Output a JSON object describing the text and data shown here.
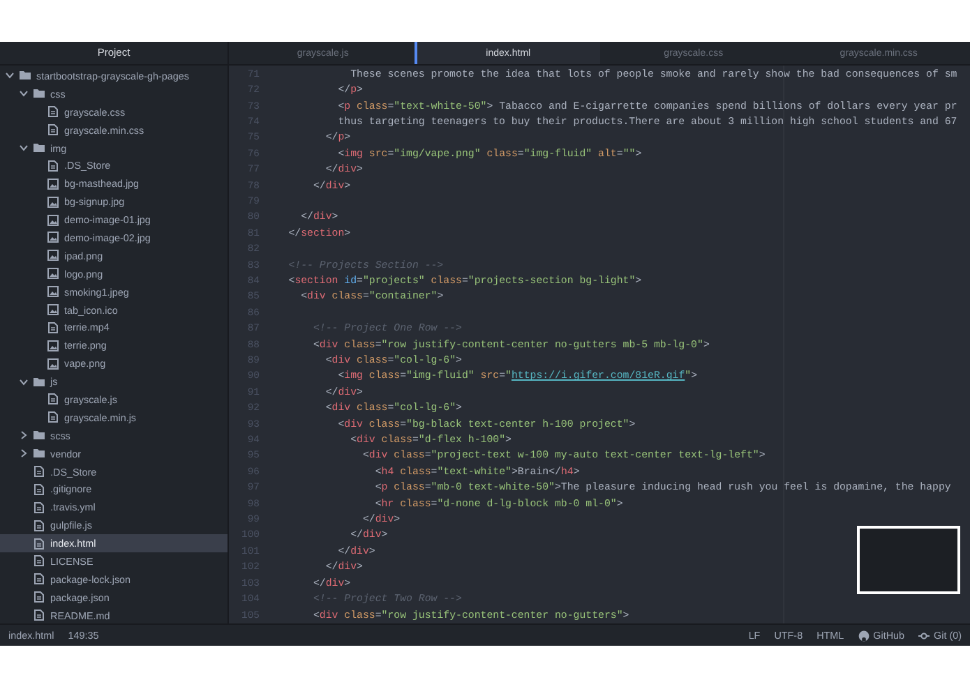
{
  "sidebar": {
    "title": "Project",
    "tree": [
      {
        "kind": "folder",
        "label": "startbootstrap-grayscale-gh-pages",
        "expanded": true,
        "selected": false,
        "children": [
          {
            "kind": "folder",
            "label": "css",
            "expanded": true,
            "selected": false,
            "children": [
              {
                "kind": "file",
                "label": "grayscale.css",
                "selected": false
              },
              {
                "kind": "file",
                "label": "grayscale.min.css",
                "selected": false
              }
            ]
          },
          {
            "kind": "folder",
            "label": "img",
            "expanded": true,
            "selected": false,
            "children": [
              {
                "kind": "file",
                "label": ".DS_Store",
                "selected": false
              },
              {
                "kind": "image",
                "label": "bg-masthead.jpg",
                "selected": false
              },
              {
                "kind": "image",
                "label": "bg-signup.jpg",
                "selected": false
              },
              {
                "kind": "image",
                "label": "demo-image-01.jpg",
                "selected": false
              },
              {
                "kind": "image",
                "label": "demo-image-02.jpg",
                "selected": false
              },
              {
                "kind": "image",
                "label": "ipad.png",
                "selected": false
              },
              {
                "kind": "image",
                "label": "logo.png",
                "selected": false
              },
              {
                "kind": "image",
                "label": "smoking1.jpeg",
                "selected": false
              },
              {
                "kind": "image",
                "label": "tab_icon.ico",
                "selected": false
              },
              {
                "kind": "file",
                "label": "terrie.mp4",
                "selected": false
              },
              {
                "kind": "image",
                "label": "terrie.png",
                "selected": false
              },
              {
                "kind": "image",
                "label": "vape.png",
                "selected": false
              }
            ]
          },
          {
            "kind": "folder",
            "label": "js",
            "expanded": true,
            "selected": false,
            "children": [
              {
                "kind": "file",
                "label": "grayscale.js",
                "selected": false
              },
              {
                "kind": "file",
                "label": "grayscale.min.js",
                "selected": false
              }
            ]
          },
          {
            "kind": "folder",
            "label": "scss",
            "expanded": false,
            "selected": false
          },
          {
            "kind": "folder",
            "label": "vendor",
            "expanded": false,
            "selected": false
          },
          {
            "kind": "file",
            "label": ".DS_Store",
            "selected": false
          },
          {
            "kind": "file",
            "label": ".gitignore",
            "selected": false
          },
          {
            "kind": "file",
            "label": ".travis.yml",
            "selected": false
          },
          {
            "kind": "file",
            "label": "gulpfile.js",
            "selected": false
          },
          {
            "kind": "file",
            "label": "index.html",
            "selected": true
          },
          {
            "kind": "file",
            "label": "LICENSE",
            "selected": false
          },
          {
            "kind": "file",
            "label": "package-lock.json",
            "selected": false
          },
          {
            "kind": "file",
            "label": "package.json",
            "selected": false
          },
          {
            "kind": "file",
            "label": "README.md",
            "selected": false
          }
        ]
      }
    ]
  },
  "tabs": [
    {
      "label": "grayscale.js",
      "selected": false
    },
    {
      "label": "index.html",
      "selected": true
    },
    {
      "label": "grayscale.css",
      "selected": false
    },
    {
      "label": "grayscale.min.css",
      "selected": false
    }
  ],
  "editor": {
    "lines": [
      {
        "number": "71",
        "tokens": [
          {
            "kind": "plain",
            "text": "              These scenes promote the idea that lots of people smoke and rarely show the bad consequences of sm"
          }
        ]
      },
      {
        "number": "72",
        "tokens": [
          {
            "kind": "plain",
            "text": "            </"
          },
          {
            "kind": "tag",
            "text": "p"
          },
          {
            "kind": "plain",
            "text": ">"
          }
        ]
      },
      {
        "number": "73",
        "tokens": [
          {
            "kind": "plain",
            "text": "            <"
          },
          {
            "kind": "tag",
            "text": "p"
          },
          {
            "kind": "attr",
            "text": " class"
          },
          {
            "kind": "plain",
            "text": "="
          },
          {
            "kind": "string",
            "text": "\"text-white-50\""
          },
          {
            "kind": "plain",
            "text": "> Tabacco and E-cigarrette companies spend billions of dollars every year pr"
          }
        ]
      },
      {
        "number": "74",
        "tokens": [
          {
            "kind": "plain",
            "text": "            thus targeting teenagers to buy their products.There are about 3 million high school students and 67"
          }
        ]
      },
      {
        "number": "75",
        "tokens": [
          {
            "kind": "plain",
            "text": "          </"
          },
          {
            "kind": "tag",
            "text": "p"
          },
          {
            "kind": "plain",
            "text": ">"
          }
        ]
      },
      {
        "number": "76",
        "tokens": [
          {
            "kind": "plain",
            "text": "            <"
          },
          {
            "kind": "tag",
            "text": "img"
          },
          {
            "kind": "attr",
            "text": " src"
          },
          {
            "kind": "plain",
            "text": "="
          },
          {
            "kind": "string",
            "text": "\"img/vape.png\""
          },
          {
            "kind": "attr",
            "text": " class"
          },
          {
            "kind": "plain",
            "text": "="
          },
          {
            "kind": "string",
            "text": "\"img-fluid\""
          },
          {
            "kind": "attr",
            "text": " alt"
          },
          {
            "kind": "plain",
            "text": "="
          },
          {
            "kind": "string",
            "text": "\"\""
          },
          {
            "kind": "plain",
            "text": ">"
          }
        ]
      },
      {
        "number": "77",
        "tokens": [
          {
            "kind": "plain",
            "text": "          </"
          },
          {
            "kind": "tag",
            "text": "div"
          },
          {
            "kind": "plain",
            "text": ">"
          }
        ]
      },
      {
        "number": "78",
        "tokens": [
          {
            "kind": "plain",
            "text": "        </"
          },
          {
            "kind": "tag",
            "text": "div"
          },
          {
            "kind": "plain",
            "text": ">"
          }
        ]
      },
      {
        "number": "79"
      },
      {
        "number": "80",
        "tokens": [
          {
            "kind": "plain",
            "text": "      </"
          },
          {
            "kind": "tag",
            "text": "div"
          },
          {
            "kind": "plain",
            "text": ">"
          }
        ]
      },
      {
        "number": "81",
        "tokens": [
          {
            "kind": "plain",
            "text": "    </"
          },
          {
            "kind": "tag",
            "text": "section"
          },
          {
            "kind": "plain",
            "text": ">"
          }
        ]
      },
      {
        "number": "82"
      },
      {
        "number": "83",
        "tokens": [
          {
            "kind": "comment",
            "text": "    <!-- Projects Section -->"
          }
        ]
      },
      {
        "number": "84",
        "tokens": [
          {
            "kind": "plain",
            "text": "    <"
          },
          {
            "kind": "tag",
            "text": "section"
          },
          {
            "kind": "attrid",
            "text": " id"
          },
          {
            "kind": "plain",
            "text": "="
          },
          {
            "kind": "string",
            "text": "\"projects\""
          },
          {
            "kind": "attr",
            "text": " class"
          },
          {
            "kind": "plain",
            "text": "="
          },
          {
            "kind": "string",
            "text": "\"projects-section bg-light\""
          },
          {
            "kind": "plain",
            "text": ">"
          }
        ]
      },
      {
        "number": "85",
        "tokens": [
          {
            "kind": "plain",
            "text": "      <"
          },
          {
            "kind": "tag",
            "text": "div"
          },
          {
            "kind": "attr",
            "text": " class"
          },
          {
            "kind": "plain",
            "text": "="
          },
          {
            "kind": "string",
            "text": "\"container\""
          },
          {
            "kind": "plain",
            "text": ">"
          }
        ]
      },
      {
        "number": "86"
      },
      {
        "number": "87",
        "tokens": [
          {
            "kind": "comment",
            "text": "        <!-- Project One Row -->"
          }
        ]
      },
      {
        "number": "88",
        "tokens": [
          {
            "kind": "plain",
            "text": "        <"
          },
          {
            "kind": "tag",
            "text": "div"
          },
          {
            "kind": "attr",
            "text": " class"
          },
          {
            "kind": "plain",
            "text": "="
          },
          {
            "kind": "string",
            "text": "\"row justify-content-center no-gutters mb-5 mb-lg-0\""
          },
          {
            "kind": "plain",
            "text": ">"
          }
        ]
      },
      {
        "number": "89",
        "tokens": [
          {
            "kind": "plain",
            "text": "          <"
          },
          {
            "kind": "tag",
            "text": "div"
          },
          {
            "kind": "attr",
            "text": " class"
          },
          {
            "kind": "plain",
            "text": "="
          },
          {
            "kind": "string",
            "text": "\"col-lg-6\""
          },
          {
            "kind": "plain",
            "text": ">"
          }
        ]
      },
      {
        "number": "90",
        "tokens": [
          {
            "kind": "plain",
            "text": "            <"
          },
          {
            "kind": "tag",
            "text": "img"
          },
          {
            "kind": "attr",
            "text": " class"
          },
          {
            "kind": "plain",
            "text": "="
          },
          {
            "kind": "string",
            "text": "\"img-fluid\""
          },
          {
            "kind": "attr",
            "text": " src"
          },
          {
            "kind": "plain",
            "text": "="
          },
          {
            "kind": "string",
            "text": "\""
          },
          {
            "kind": "link",
            "text": "https://i.gifer.com/81eR.gif"
          },
          {
            "kind": "string",
            "text": "\""
          },
          {
            "kind": "plain",
            "text": ">"
          }
        ]
      },
      {
        "number": "91",
        "tokens": [
          {
            "kind": "plain",
            "text": "          </"
          },
          {
            "kind": "tag",
            "text": "div"
          },
          {
            "kind": "plain",
            "text": ">"
          }
        ]
      },
      {
        "number": "92",
        "tokens": [
          {
            "kind": "plain",
            "text": "          <"
          },
          {
            "kind": "tag",
            "text": "div"
          },
          {
            "kind": "attr",
            "text": " class"
          },
          {
            "kind": "plain",
            "text": "="
          },
          {
            "kind": "string",
            "text": "\"col-lg-6\""
          },
          {
            "kind": "plain",
            "text": ">"
          }
        ]
      },
      {
        "number": "93",
        "tokens": [
          {
            "kind": "plain",
            "text": "            <"
          },
          {
            "kind": "tag",
            "text": "div"
          },
          {
            "kind": "attr",
            "text": " class"
          },
          {
            "kind": "plain",
            "text": "="
          },
          {
            "kind": "string",
            "text": "\"bg-black text-center h-100 project\""
          },
          {
            "kind": "plain",
            "text": ">"
          }
        ]
      },
      {
        "number": "94",
        "tokens": [
          {
            "kind": "plain",
            "text": "              <"
          },
          {
            "kind": "tag",
            "text": "div"
          },
          {
            "kind": "attr",
            "text": " class"
          },
          {
            "kind": "plain",
            "text": "="
          },
          {
            "kind": "string",
            "text": "\"d-flex h-100\""
          },
          {
            "kind": "plain",
            "text": ">"
          }
        ]
      },
      {
        "number": "95",
        "tokens": [
          {
            "kind": "plain",
            "text": "                <"
          },
          {
            "kind": "tag",
            "text": "div"
          },
          {
            "kind": "attr",
            "text": " class"
          },
          {
            "kind": "plain",
            "text": "="
          },
          {
            "kind": "string",
            "text": "\"project-text w-100 my-auto text-center text-lg-left\""
          },
          {
            "kind": "plain",
            "text": ">"
          }
        ]
      },
      {
        "number": "96",
        "tokens": [
          {
            "kind": "plain",
            "text": "                  <"
          },
          {
            "kind": "tag",
            "text": "h4"
          },
          {
            "kind": "attr",
            "text": " class"
          },
          {
            "kind": "plain",
            "text": "="
          },
          {
            "kind": "string",
            "text": "\"text-white\""
          },
          {
            "kind": "plain",
            "text": ">Brain</"
          },
          {
            "kind": "tag",
            "text": "h4"
          },
          {
            "kind": "plain",
            "text": ">"
          }
        ]
      },
      {
        "number": "97",
        "tokens": [
          {
            "kind": "plain",
            "text": "                  <"
          },
          {
            "kind": "tag",
            "text": "p"
          },
          {
            "kind": "attr",
            "text": " class"
          },
          {
            "kind": "plain",
            "text": "="
          },
          {
            "kind": "string",
            "text": "\"mb-0 text-white-50\""
          },
          {
            "kind": "plain",
            "text": ">The pleasure inducing head rush you feel is dopamine, the happy"
          }
        ]
      },
      {
        "number": "98",
        "tokens": [
          {
            "kind": "plain",
            "text": "                  <"
          },
          {
            "kind": "tag",
            "text": "hr"
          },
          {
            "kind": "attr",
            "text": " class"
          },
          {
            "kind": "plain",
            "text": "="
          },
          {
            "kind": "string",
            "text": "\"d-none d-lg-block mb-0 ml-0\""
          },
          {
            "kind": "plain",
            "text": ">"
          }
        ]
      },
      {
        "number": "99",
        "tokens": [
          {
            "kind": "plain",
            "text": "                </"
          },
          {
            "kind": "tag",
            "text": "div"
          },
          {
            "kind": "plain",
            "text": ">"
          }
        ]
      },
      {
        "number": "100",
        "tokens": [
          {
            "kind": "plain",
            "text": "              </"
          },
          {
            "kind": "tag",
            "text": "div"
          },
          {
            "kind": "plain",
            "text": ">"
          }
        ]
      },
      {
        "number": "101",
        "tokens": [
          {
            "kind": "plain",
            "text": "            </"
          },
          {
            "kind": "tag",
            "text": "div"
          },
          {
            "kind": "plain",
            "text": ">"
          }
        ]
      },
      {
        "number": "102",
        "tokens": [
          {
            "kind": "plain",
            "text": "          </"
          },
          {
            "kind": "tag",
            "text": "div"
          },
          {
            "kind": "plain",
            "text": ">"
          }
        ]
      },
      {
        "number": "103",
        "tokens": [
          {
            "kind": "plain",
            "text": "        </"
          },
          {
            "kind": "tag",
            "text": "div"
          },
          {
            "kind": "plain",
            "text": ">"
          }
        ]
      },
      {
        "number": "104",
        "tokens": [
          {
            "kind": "comment",
            "text": "        <!-- Project Two Row -->"
          }
        ]
      },
      {
        "number": "105",
        "tokens": [
          {
            "kind": "plain",
            "text": "        <"
          },
          {
            "kind": "tag",
            "text": "div"
          },
          {
            "kind": "attr",
            "text": " class"
          },
          {
            "kind": "plain",
            "text": "="
          },
          {
            "kind": "string",
            "text": "\"row justify-content-center no-gutters\""
          },
          {
            "kind": "plain",
            "text": ">"
          }
        ]
      }
    ]
  },
  "status_bar": {
    "file": "index.html",
    "cursor": "149:35",
    "line_ending": "LF",
    "encoding": "UTF-8",
    "grammar": "HTML",
    "github": "GitHub",
    "git": "Git (0)"
  }
}
